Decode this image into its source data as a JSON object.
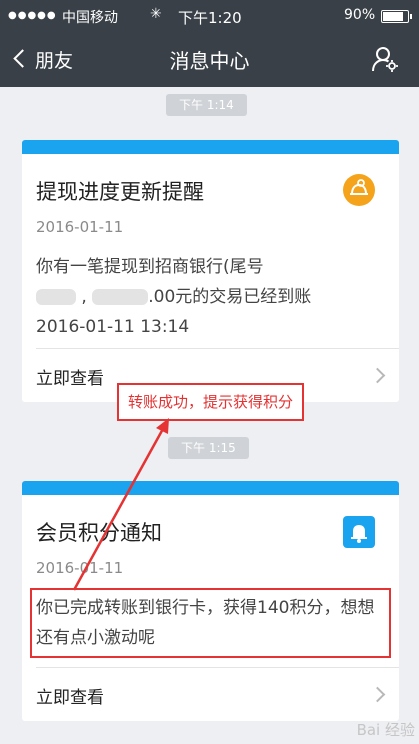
{
  "status_bar": {
    "signal": "●●●●●",
    "carrier": "中国移动",
    "wifi": "〈",
    "loading": "✳",
    "time": "下午1:20",
    "battery": "90%",
    "battery_level": 0.9
  },
  "nav": {
    "back_label": "朋友",
    "title": "消息中心",
    "user_icon": "user-settings-icon"
  },
  "messages": [
    {
      "timestamp": "下午 1:14",
      "title": "提现进度更新提醒",
      "icon": "coin-icon",
      "date": "2016-01-11",
      "body_line1": "你有一笔提现到招商银行(尾号",
      "body_line2_suffix": ".00元的交易已经到账",
      "body_line3": "2016-01-11 13:14",
      "view_label": "立即查看"
    },
    {
      "timestamp": "下午 1:15",
      "title": "会员积分通知",
      "icon": "bell-icon",
      "date": "2016-01-11",
      "body": "你已完成转账到银行卡，获得140积分，想想还有点小激动呢",
      "view_label": "立即查看"
    }
  ],
  "annotation": {
    "label": "转账成功，提示获得积分",
    "color": "#e53232"
  },
  "colors": {
    "header": "#3a4047",
    "accent": "#1aa3ef",
    "coin": "#f5a31a",
    "background": "#eeeff3"
  },
  "watermark": "Bai 经验"
}
